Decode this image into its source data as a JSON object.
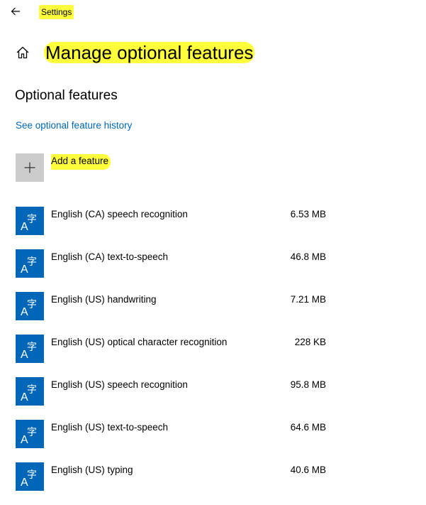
{
  "window": {
    "title": "Settings",
    "back_icon": "arrow-left-icon"
  },
  "header": {
    "title": "Manage optional features",
    "home_icon": "home-icon"
  },
  "section": {
    "title": "Optional features",
    "history_link": "See optional feature history"
  },
  "add_feature": {
    "label": "Add a feature",
    "icon": "plus-icon"
  },
  "features": [
    {
      "name": "English (CA) speech recognition",
      "size": "6.53 MB",
      "icon": "language-icon"
    },
    {
      "name": "English (CA) text-to-speech",
      "size": "46.8 MB",
      "icon": "language-icon"
    },
    {
      "name": "English (US) handwriting",
      "size": "7.21 MB",
      "icon": "language-icon"
    },
    {
      "name": "English (US) optical character recognition",
      "size": "228 KB",
      "icon": "language-icon"
    },
    {
      "name": "English (US) speech recognition",
      "size": "95.8 MB",
      "icon": "language-icon"
    },
    {
      "name": "English (US) text-to-speech",
      "size": "64.6 MB",
      "icon": "language-icon"
    },
    {
      "name": "English (US) typing",
      "size": "40.6 MB",
      "icon": "language-icon"
    }
  ],
  "colors": {
    "accent": "#0067b8",
    "highlight": "#ffff3b",
    "tile_gray": "#cccccc"
  }
}
